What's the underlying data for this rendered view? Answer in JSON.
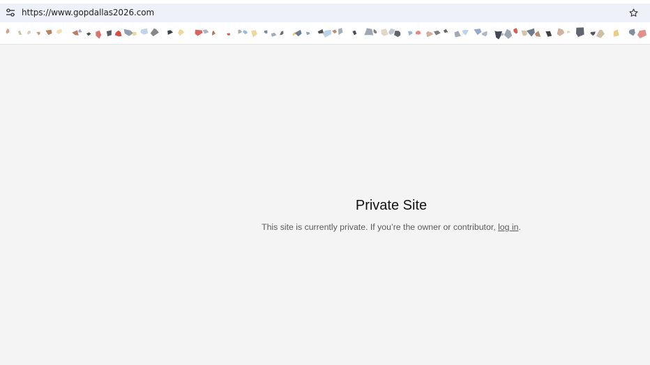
{
  "browser": {
    "url": "https://www.gopdallas2026.com",
    "site_info_icon": "tune-icon",
    "bookmark_star_icon": "star-outline-icon"
  },
  "bookmarks_bar": {
    "favicon_colors": [
      "#6b7a8c",
      "#c9b79a",
      "#3a3a3a",
      "#8fb4d9",
      "#b07a5a",
      "#1e2433",
      "#e8c97a",
      "#d0463e",
      "#4a6fa5",
      "#9aa4b0"
    ]
  },
  "page": {
    "title": "Private Site",
    "message_before": "This site is currently private. If you’re the owner or contributor, ",
    "login_link": "log in",
    "message_after": "."
  }
}
